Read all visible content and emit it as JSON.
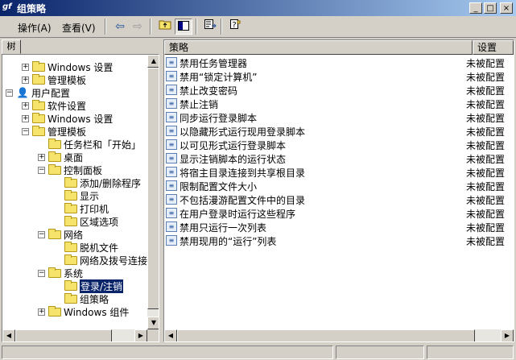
{
  "window": {
    "title": "组策略",
    "app_icon": "gf"
  },
  "menu": {
    "action": "操作(A)",
    "view": "查看(V)"
  },
  "toolbar_icons": [
    "back-arrow-icon",
    "forward-arrow-icon",
    "up-folder-icon",
    "show-hide-tree-icon",
    "export-list-icon",
    "help-icon"
  ],
  "tree": {
    "tab_label": "树",
    "nodes": [
      {
        "label": "Windows 设置",
        "level": 1,
        "expander": "+"
      },
      {
        "label": "管理模板",
        "level": 1,
        "expander": "+"
      },
      {
        "label": "用户配置",
        "level": 0,
        "expander": "−"
      },
      {
        "label": "软件设置",
        "level": 1,
        "expander": "+"
      },
      {
        "label": "Windows 设置",
        "level": 1,
        "expander": "+"
      },
      {
        "label": "管理模板",
        "level": 1,
        "expander": "−"
      },
      {
        "label": "任务栏和「开始」",
        "level": 2,
        "expander": ""
      },
      {
        "label": "桌面",
        "level": 2,
        "expander": "+"
      },
      {
        "label": "控制面板",
        "level": 2,
        "expander": "−"
      },
      {
        "label": "添加/删除程序",
        "level": 3,
        "expander": ""
      },
      {
        "label": "显示",
        "level": 3,
        "expander": ""
      },
      {
        "label": "打印机",
        "level": 3,
        "expander": ""
      },
      {
        "label": "区域选项",
        "level": 3,
        "expander": ""
      },
      {
        "label": "网络",
        "level": 2,
        "expander": "−"
      },
      {
        "label": "脱机文件",
        "level": 3,
        "expander": ""
      },
      {
        "label": "网络及拨号连接",
        "level": 3,
        "expander": ""
      },
      {
        "label": "系统",
        "level": 2,
        "expander": "−"
      },
      {
        "label": "登录/注销",
        "level": 3,
        "expander": ""
      },
      {
        "label": "组策略",
        "level": 3,
        "expander": ""
      },
      {
        "label": "Windows 组件",
        "level": 2,
        "expander": "+"
      }
    ]
  },
  "list": {
    "columns": {
      "policy": "策略",
      "setting": "设置"
    },
    "rows": [
      {
        "name": "禁用任务管理器",
        "state": "未被配置"
      },
      {
        "name": "禁用“锁定计算机”",
        "state": "未被配置"
      },
      {
        "name": "禁止改变密码",
        "state": "未被配置"
      },
      {
        "name": "禁止注销",
        "state": "未被配置"
      },
      {
        "name": "同步运行登录脚本",
        "state": "未被配置"
      },
      {
        "name": "以隐藏形式运行现用登录脚本",
        "state": "未被配置"
      },
      {
        "name": "以可见形式运行登录脚本",
        "state": "未被配置"
      },
      {
        "name": "显示注销脚本的运行状态",
        "state": "未被配置"
      },
      {
        "name": "将宿主目录连接到共享根目录",
        "state": "未被配置"
      },
      {
        "name": "限制配置文件大小",
        "state": "未被配置"
      },
      {
        "name": "不包括漫游配置文件中的目录",
        "state": "未被配置"
      },
      {
        "name": "在用户登录时运行这些程序",
        "state": "未被配置"
      },
      {
        "name": "禁用只运行一次列表",
        "state": "未被配置"
      },
      {
        "name": "禁用现用的“运行”列表",
        "state": "未被配置"
      }
    ]
  }
}
